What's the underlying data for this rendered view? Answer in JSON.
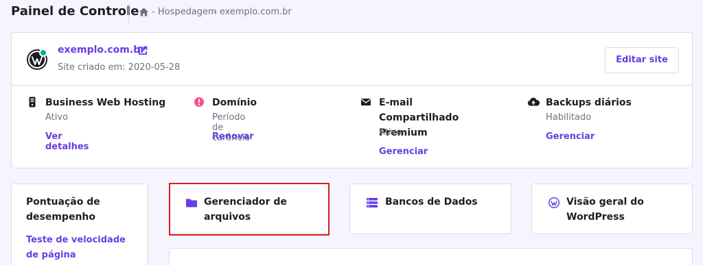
{
  "header": {
    "title": "Painel de Controle",
    "breadcrumb": [
      "- Hospedagem",
      "- exemplo.com.br"
    ]
  },
  "site": {
    "domain": "exemplo.com.br",
    "created": "Site criado em: 2020-05-28",
    "edit_label": "Editar site",
    "status_color": "#00b090"
  },
  "services": [
    {
      "icon": "phone-server-icon",
      "title": "Business Web Hosting",
      "status": "Ativo",
      "link": "Ver detalhes"
    },
    {
      "icon": "alert-icon",
      "title": "Domínio",
      "status": "Período de carência",
      "link": "Renovar"
    },
    {
      "icon": "mail-icon",
      "title": "E-mail Compartilhado Premium",
      "status": "Ativo",
      "link": "Gerenciar"
    },
    {
      "icon": "cloud-upload-icon",
      "title": "Backups diários",
      "status": "Habilitado",
      "link": "Gerenciar"
    }
  ],
  "tiles": {
    "performance": {
      "title": "Pontuação de desempenho",
      "link": "Teste de velocidade de página"
    },
    "file_manager": {
      "icon": "folder-icon",
      "title": "Gerenciador de arquivos"
    },
    "databases": {
      "icon": "database-icon",
      "title": "Bancos de Dados"
    },
    "wordpress": {
      "icon": "wordpress-icon",
      "title": "Visão geral do WordPress"
    }
  },
  "colors": {
    "accent": "#673de6",
    "alert": "#fc5185",
    "highlight": "#e01b1b"
  }
}
